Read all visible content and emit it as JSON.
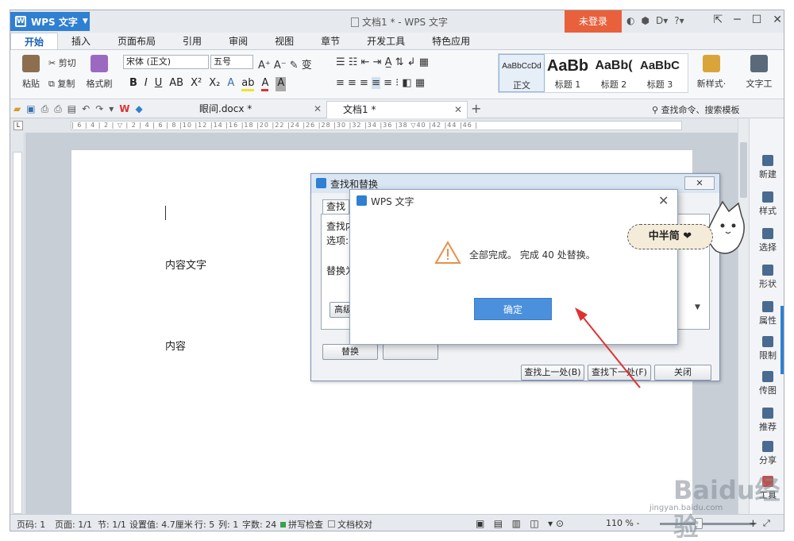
{
  "app": {
    "menu_label": "WPS 文字",
    "window_title": "文档1 * - WPS 文字",
    "login_label": "未登录"
  },
  "ribbon_tabs": [
    "开始",
    "插入",
    "页面布局",
    "引用",
    "审阅",
    "视图",
    "章节",
    "开发工具",
    "特色应用"
  ],
  "ribbon": {
    "paste": "粘贴",
    "cut": "剪切",
    "copy": "复制",
    "format_painter": "格式刷",
    "font_name": "宋体 (正文)",
    "font_size": "五号",
    "styles": [
      {
        "sample": "AaBbCcDd",
        "name": "正文"
      },
      {
        "sample": "AaBb",
        "name": "标题 1"
      },
      {
        "sample": "AaBb(",
        "name": "标题 2"
      },
      {
        "sample": "AaBbC",
        "name": "标题 3"
      }
    ],
    "new_style": "新样式·",
    "text_tools": "文字工"
  },
  "doc_tabs": [
    {
      "label": "眼间.docx *"
    },
    {
      "label": "文档1 *"
    }
  ],
  "search_cmd": "查找命令、搜索模板",
  "task_pane": [
    "新建",
    "样式",
    "选择",
    "形状",
    "属性",
    "限制",
    "传图",
    "推荐",
    "分享",
    "工具"
  ],
  "document": {
    "line1": "内容文字",
    "line2": "内容"
  },
  "find_replace": {
    "title": "查找和替换",
    "tab_find": "查找",
    "find_label": "查找内",
    "options_label": "选项:",
    "replace_label": "替换为",
    "advanced": "高级",
    "replace_btn": "替换",
    "prev": "查找上一处(B)",
    "next": "查找下一处(F)",
    "close": "关闭"
  },
  "message": {
    "title": "WPS 文字",
    "text": "全部完成。 完成 40 处替换。",
    "ok": "确定"
  },
  "sticker": {
    "text": "中半简 ❤"
  },
  "status_bar": {
    "page_no": "页码: 1",
    "pages": "页面: 1/1",
    "section": "节: 1/1",
    "setting": "设置值: 4.7厘米",
    "row": "行: 5",
    "col": "列: 1",
    "words": "字数: 24",
    "spell": "拼写检查",
    "compare": "文档校对",
    "zoom": "110 % -"
  },
  "watermark": {
    "text": "Baidu经验",
    "url": "jingyan.baidu.com"
  },
  "colors": {
    "accent": "#2f7fd2",
    "login": "#e8603c",
    "ok_button": "#4a90dd",
    "arrow": "#e03030"
  }
}
